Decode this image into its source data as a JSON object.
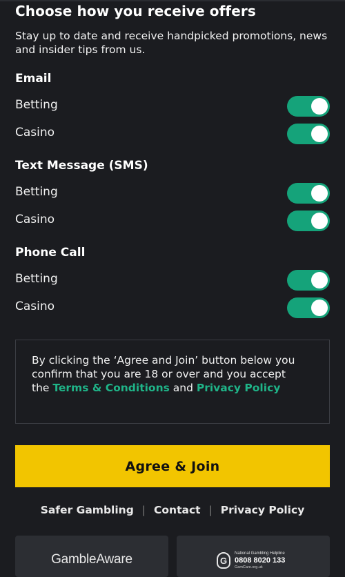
{
  "header": {
    "title": "Choose how you receive offers",
    "subtitle": "Stay up to date and receive handpicked promotions, news and insider tips from us."
  },
  "sections": [
    {
      "heading": "Email",
      "rows": [
        {
          "label": "Betting",
          "on": true
        },
        {
          "label": "Casino",
          "on": true
        }
      ]
    },
    {
      "heading": "Text Message (SMS)",
      "rows": [
        {
          "label": "Betting",
          "on": true
        },
        {
          "label": "Casino",
          "on": true
        }
      ]
    },
    {
      "heading": "Phone Call",
      "rows": [
        {
          "label": "Betting",
          "on": true
        },
        {
          "label": "Casino",
          "on": true
        }
      ]
    }
  ],
  "consent": {
    "text_before": "By clicking the ‘Agree and Join’ button below you confirm that you are 18 or over and you accept the ",
    "terms_link": "Terms & Conditions",
    "text_and": " and ",
    "privacy_link": "Privacy Policy"
  },
  "agree_button": "Agree & Join",
  "footer": {
    "links": [
      "Safer Gambling",
      "Contact",
      "Privacy Policy"
    ],
    "separator": "|"
  },
  "badges": {
    "gambleaware": "GambleAware",
    "gamcare_logo": "G",
    "gamcare_title": "National Gambling Helpline",
    "gamcare_number": "0808 8020 133",
    "gamcare_site": "GamCare.org.uk"
  },
  "colors": {
    "background": "#1b1c20",
    "toggle_on": "#15a37a",
    "link": "#1fb488",
    "button": "#f2c500"
  }
}
